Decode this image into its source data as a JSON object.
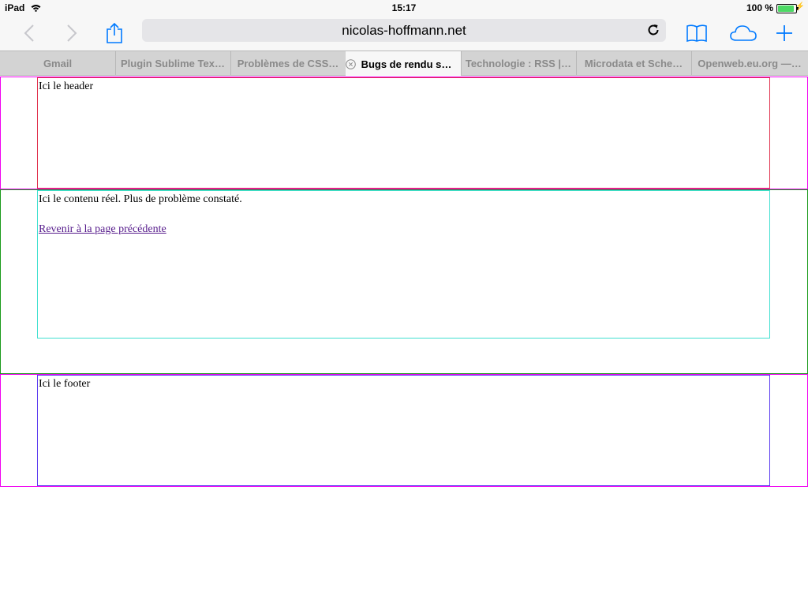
{
  "status_bar": {
    "device": "iPad",
    "time": "15:17",
    "battery": "100 %",
    "battery_level": 1.0
  },
  "toolbar": {
    "url": "nicolas-hoffmann.net",
    "icons": [
      "back-icon",
      "forward-icon",
      "share-icon",
      "reload-icon",
      "bookmarks-icon",
      "icloud-tabs-icon",
      "new-tab-icon"
    ]
  },
  "tabs": [
    {
      "label": "Gmail",
      "active": false
    },
    {
      "label": "Plugin Sublime Tex…",
      "active": false
    },
    {
      "label": "Problèmes de CSS…",
      "active": false
    },
    {
      "label": "Bugs de rendu s…",
      "active": true
    },
    {
      "label": "Technologie : RSS |…",
      "active": false
    },
    {
      "label": "Microdata et Sche…",
      "active": false
    },
    {
      "label": "Openweb.eu.org —…",
      "active": false
    }
  ],
  "page": {
    "header_text": "Ici le header",
    "content_text": "Ici le contenu réel. Plus de problème constaté.",
    "back_link": "Revenir à la page précédente",
    "footer_text": "Ici le footer"
  },
  "colors": {
    "accent": "#007aff",
    "outer_border": "#f000f0",
    "header_border": "#e0304c",
    "main_outer_border": "#1a9a1a",
    "main_inner_border": "#40e0d0",
    "footer_border": "#5a3af0",
    "link": "#551a8b"
  }
}
